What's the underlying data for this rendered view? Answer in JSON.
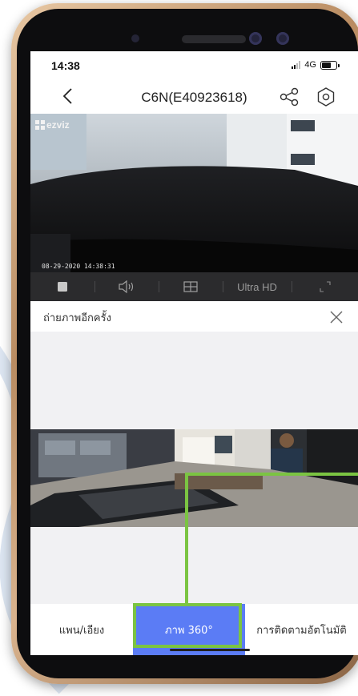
{
  "status_bar": {
    "time": "14:38",
    "network": "4G"
  },
  "nav": {
    "title": "C6N(E40923618)",
    "back_icon": "chevron-left-icon",
    "share_icon": "share-icon",
    "settings_icon": "gear-icon"
  },
  "video": {
    "brand": "ezviz",
    "timestamp": "08-29-2020 14:38:31"
  },
  "controls": {
    "stop_icon": "stop-icon",
    "sound_icon": "speaker-icon",
    "layout_icon": "split-view-icon",
    "quality": "Ultra HD",
    "fullscreen_icon": "expand-icon"
  },
  "capture": {
    "label": "ถ่ายภาพอีกครั้ง",
    "close_icon": "close-icon"
  },
  "tabs": [
    {
      "label": "แพน/เอียง",
      "active": false
    },
    {
      "label": "ภาพ 360°",
      "active": true
    },
    {
      "label": "การติดตามอัตโนมัติ",
      "active": false
    }
  ],
  "colors": {
    "accent": "#5b7cf5",
    "highlight": "#7bc442",
    "control_bar": "#2b2b2d"
  }
}
